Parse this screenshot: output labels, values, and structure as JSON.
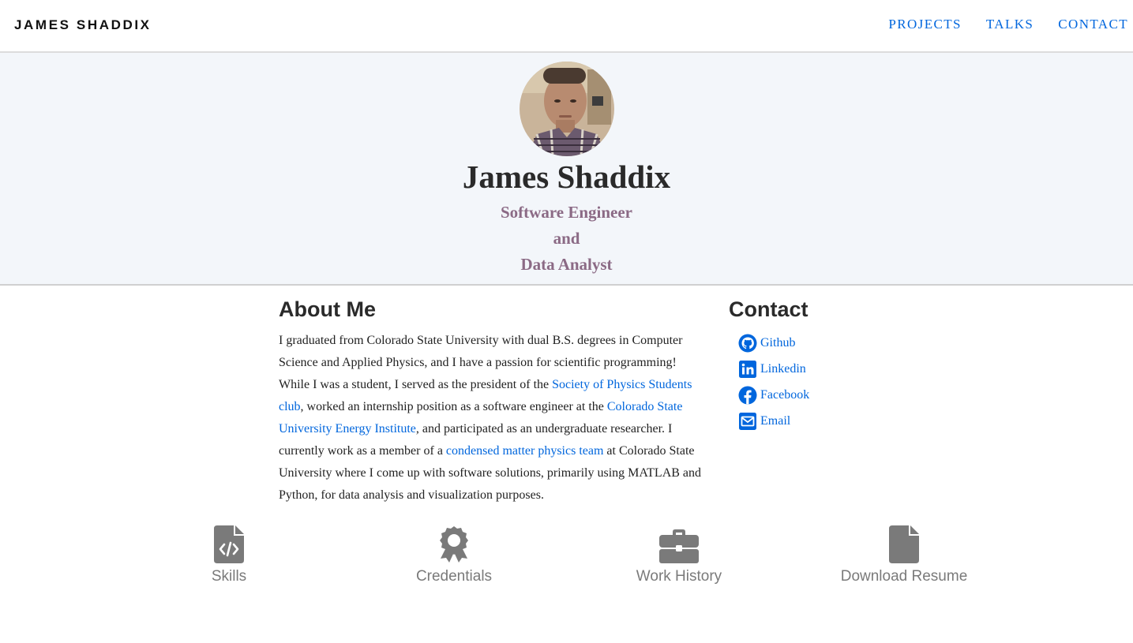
{
  "nav": {
    "brand": "JAMES SHADDIX",
    "links": [
      "PROJECTS",
      "TALKS",
      "CONTACT"
    ]
  },
  "hero": {
    "name": "James Shaddix",
    "subtitle_lines": [
      "Software Engineer",
      "and",
      "Data Analyst"
    ]
  },
  "about": {
    "title": "About Me",
    "text_1": "I graduated from Colorado State University with dual B.S. degrees in Computer Science and Applied Physics, and I have a passion for scientific programming! While I was a student, I served as the president of the ",
    "link_1": "Society of Physics Students club",
    "text_2": ", worked an internship position as a software engineer at the ",
    "link_2": "Colorado State University Energy Institute",
    "text_3": ", and participated as an undergraduate researcher. I currently work as a member of a ",
    "link_3": "condensed matter physics team",
    "text_4": " at Colorado State University where I come up with software solutions, primarily using MATLAB and Python, for data analysis and visualization purposes."
  },
  "contact": {
    "title": "Contact",
    "items": [
      {
        "label": "Github",
        "icon": "github-icon"
      },
      {
        "label": "Linkedin",
        "icon": "linkedin-icon"
      },
      {
        "label": "Facebook",
        "icon": "facebook-icon"
      },
      {
        "label": "Email",
        "icon": "envelope-icon"
      }
    ]
  },
  "tiles": [
    {
      "label": "Skills",
      "icon": "file-code-icon"
    },
    {
      "label": "Credentials",
      "icon": "award-icon"
    },
    {
      "label": "Work History",
      "icon": "briefcase-icon"
    },
    {
      "label": "Download Resume",
      "icon": "file-icon"
    }
  ],
  "colors": {
    "link": "#0066dd",
    "hero_bg": "#f3f6fa",
    "subtitle": "#8b6a85",
    "tile_icon": "#7a7a7a"
  }
}
